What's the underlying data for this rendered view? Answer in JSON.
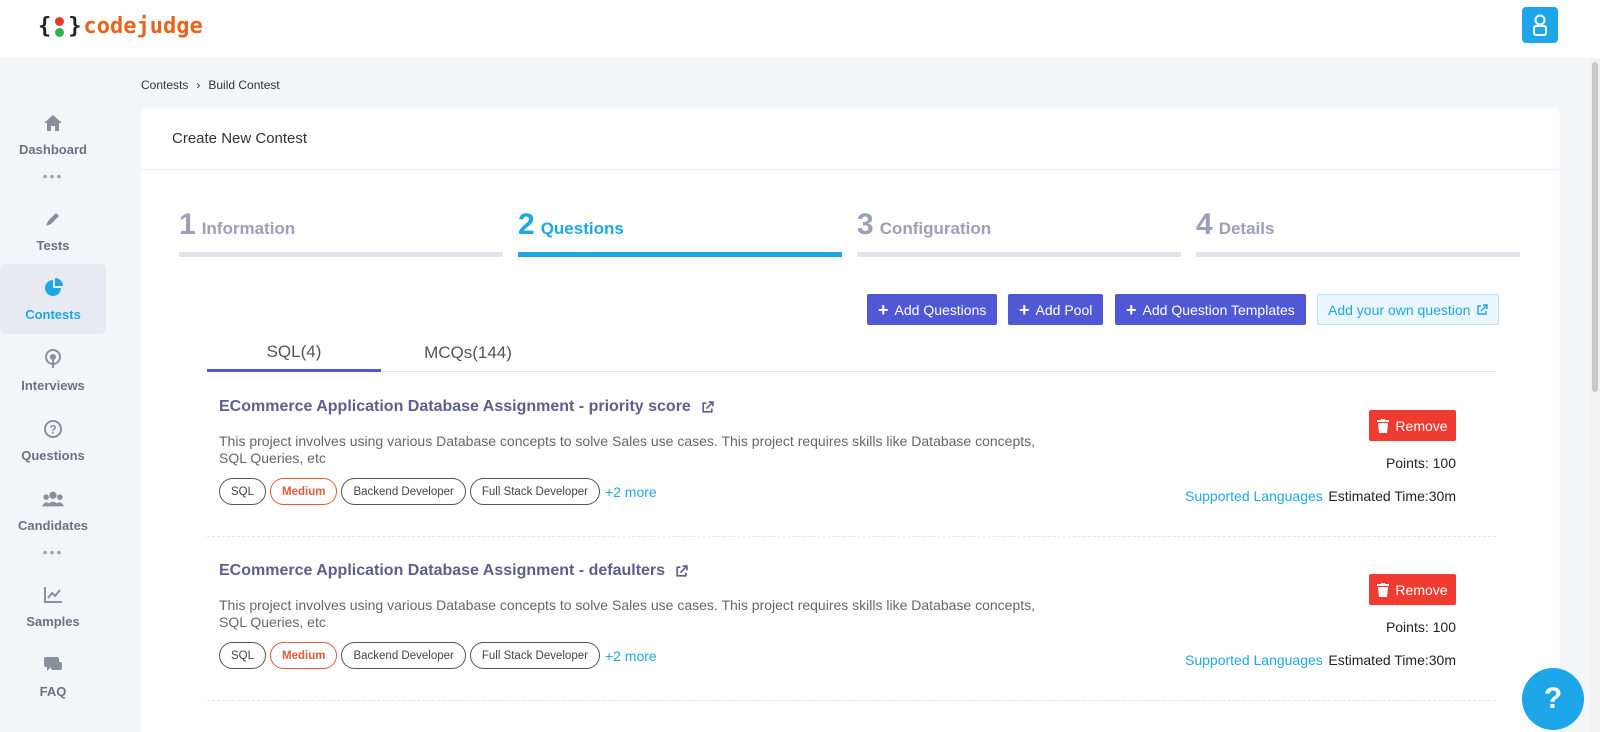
{
  "brand": {
    "word": "codejudge",
    "open_brace": "{",
    "close_brace": "}",
    "colors": {
      "accent": "#1ea7e8",
      "primary_btn": "#5058d6",
      "danger": "#f03c30",
      "logo": "#e8631c"
    }
  },
  "header": {
    "profile_icon": "user-icon"
  },
  "sidebar": {
    "items": [
      {
        "label": "Dashboard",
        "icon": "home-icon"
      },
      {
        "label": "Tests",
        "icon": "pencil-icon"
      },
      {
        "label": "Contests",
        "icon": "pie-chart-icon",
        "active": true
      },
      {
        "label": "Interviews",
        "icon": "broadcast-icon"
      },
      {
        "label": "Questions",
        "icon": "question-circle-icon"
      },
      {
        "label": "Candidates",
        "icon": "users-icon"
      },
      {
        "label": "Samples",
        "icon": "line-chart-icon"
      },
      {
        "label": "FAQ",
        "icon": "chat-icon"
      }
    ],
    "dots": "•••"
  },
  "breadcrumb": {
    "items": [
      "Contests",
      "Build Contest"
    ],
    "separator": "›"
  },
  "card": {
    "title": "Create New Contest"
  },
  "steps": [
    {
      "num": "1",
      "label": "Information"
    },
    {
      "num": "2",
      "label": "Questions",
      "active": true
    },
    {
      "num": "3",
      "label": "Configuration"
    },
    {
      "num": "4",
      "label": "Details"
    }
  ],
  "actions": {
    "plus": "+",
    "add_questions": "Add Questions",
    "add_pool": "Add Pool",
    "add_templates": "Add Question Templates",
    "add_own": "Add your own question"
  },
  "tabs": [
    {
      "label": "SQL(4)",
      "active": true
    },
    {
      "label": "MCQs(144)"
    }
  ],
  "questions": [
    {
      "title": "ECommerce Application Database Assignment - priority score",
      "description": "This project involves using various Database concepts to solve Sales use cases. This project requires skills like Database concepts, SQL Queries, etc",
      "tags": [
        "SQL",
        "Medium",
        "Backend Developer",
        "Full Stack Developer"
      ],
      "more": "+2 more",
      "remove_label": "Remove",
      "points": "Points: 100",
      "languages_link": "Supported Languages",
      "estimated": "Estimated Time:30m"
    },
    {
      "title": "ECommerce Application Database Assignment - defaulters",
      "description": "This project involves using various Database concepts to solve Sales use cases. This project requires skills like Database concepts, SQL Queries, etc",
      "tags": [
        "SQL",
        "Medium",
        "Backend Developer",
        "Full Stack Developer"
      ],
      "more": "+2 more",
      "remove_label": "Remove",
      "points": "Points: 100",
      "languages_link": "Supported Languages",
      "estimated": "Estimated Time:30m"
    }
  ],
  "help": {
    "label": "?"
  }
}
